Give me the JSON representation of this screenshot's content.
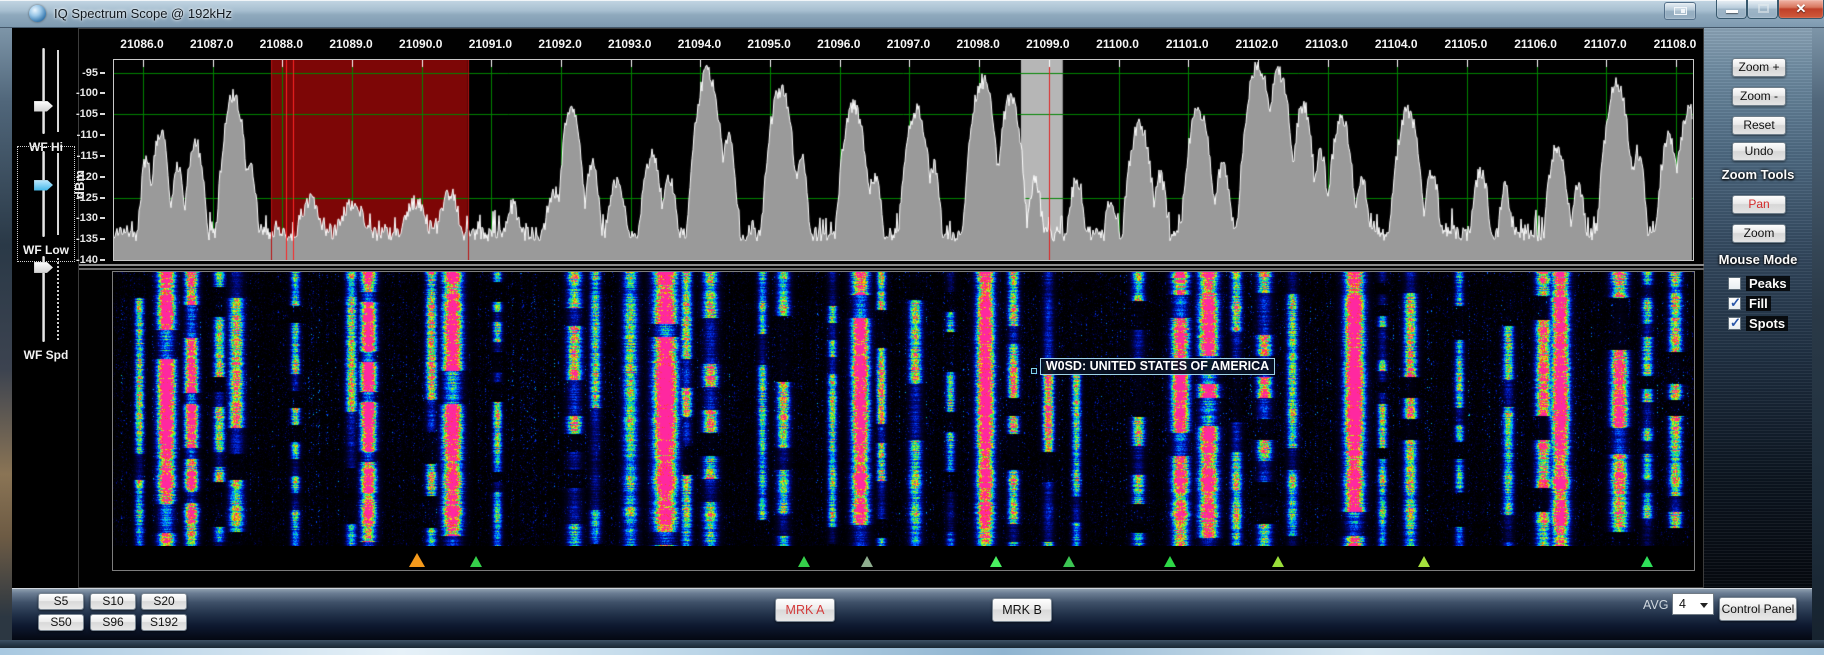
{
  "window": {
    "title": "IQ Spectrum Scope @ 192kHz",
    "close_glyph": "✕"
  },
  "left_rail": {
    "sliders": [
      {
        "label": "WF Hi",
        "value": 0.7,
        "focused": false,
        "ticks": "solid"
      },
      {
        "label": "WF Low",
        "value": 0.38,
        "focused": true,
        "ticks": "solid"
      },
      {
        "label": "WF Spd",
        "value": 0.08,
        "focused": false,
        "ticks": "dotted"
      }
    ]
  },
  "right_rail": {
    "buttons_zoom": [
      {
        "label": "Zoom +"
      },
      {
        "label": "Zoom -"
      },
      {
        "label": "Reset"
      },
      {
        "label": "Undo"
      }
    ],
    "zoom_tools_label": "Zoom Tools",
    "buttons_mouse": [
      {
        "label": "Pan",
        "active": true
      },
      {
        "label": "Zoom",
        "active": false
      }
    ],
    "mouse_mode_label": "Mouse Mode",
    "checkboxes": [
      {
        "label": "Peaks",
        "checked": false
      },
      {
        "label": "Fill",
        "checked": true
      },
      {
        "label": "Spots",
        "checked": true
      }
    ],
    "active_text_color": "#d42a2a"
  },
  "bottom_bar": {
    "span_buttons": [
      "S5",
      "S10",
      "S20",
      "S50",
      "S96",
      "S192"
    ],
    "mrk_a_label": "MRK A",
    "mrk_b_label": "MRK B",
    "avg_label": "AVG",
    "avg_value": "4",
    "control_panel_label": "Control Panel"
  },
  "waterfall_tooltip": {
    "text": "W0SD: UNITED STATES OF AMERICA",
    "anchor_khz": 21099.0
  },
  "chart_data": {
    "type": "spectrum-and-waterfall",
    "x_axis": {
      "unit": "kHz",
      "start": 21086.0,
      "end": 21108.0,
      "step": 1.0,
      "tick_labels": [
        "21086.0",
        "21087.0",
        "21088.0",
        "21089.0",
        "21090.0",
        "21091.0",
        "21092.0",
        "21093.0",
        "21094.0",
        "21095.0",
        "21096.0",
        "21097.0",
        "21098.0",
        "21099.0",
        "21100.0",
        "21101.0",
        "21102.0",
        "21103.0",
        "21104.0",
        "21105.0",
        "21106.0",
        "21107.0",
        "21108.0"
      ],
      "plot_start": 21085.58,
      "plot_end": 21108.26
    },
    "y_axis": {
      "label": "dBm",
      "tick_labels": [
        "-95",
        "-100",
        "-105",
        "-110",
        "-115",
        "-120",
        "-125",
        "-130",
        "-135",
        "-140"
      ],
      "top_dbm": -92,
      "bottom_dbm": -140
    },
    "grid": {
      "color": "#008500",
      "vertical_khz_every": 1.0,
      "horizontal_dbm": [
        -95,
        -105,
        -125
      ]
    },
    "noise_floor_dbm": -134,
    "spectrum_fill_color": "#9a9a9a",
    "spectrum_line_color": "#ffffff",
    "regions": [
      {
        "name": "selection-red",
        "from_khz": 21087.84,
        "to_khz": 21090.66,
        "fill": "#7d0606",
        "edge_line_color": "#b81212",
        "inner_lines_khz": [
          21088.05,
          21088.15
        ],
        "inner_line_color": "#ff2424"
      },
      {
        "name": "marker-band-gray",
        "from_khz": 21098.6,
        "to_khz": 21099.2,
        "fill": "#b6b6b6",
        "center_line_khz": 21099.0,
        "center_line_color": "#e02020"
      }
    ],
    "peaks_format": "[kHz, dBm, width_kHz]",
    "peaks": [
      [
        21086.05,
        -116,
        0.06
      ],
      [
        21086.25,
        -109,
        0.07
      ],
      [
        21086.5,
        -117,
        0.06
      ],
      [
        21086.75,
        -112,
        0.08
      ],
      [
        21087.3,
        -100,
        0.09
      ],
      [
        21087.55,
        -118,
        0.06
      ],
      [
        21088.4,
        -126,
        0.15
      ],
      [
        21089.0,
        -127,
        0.2
      ],
      [
        21089.9,
        -126,
        0.15
      ],
      [
        21090.4,
        -124,
        0.12
      ],
      [
        21091.3,
        -127,
        0.1
      ],
      [
        21091.9,
        -124,
        0.1
      ],
      [
        21092.15,
        -103,
        0.08
      ],
      [
        21092.45,
        -117,
        0.07
      ],
      [
        21092.8,
        -121,
        0.1
      ],
      [
        21093.3,
        -115,
        0.09
      ],
      [
        21093.55,
        -120,
        0.08
      ],
      [
        21094.1,
        -95,
        0.1
      ],
      [
        21094.4,
        -111,
        0.07
      ],
      [
        21095.15,
        -99,
        0.1
      ],
      [
        21095.45,
        -115,
        0.06
      ],
      [
        21096.2,
        -103,
        0.1
      ],
      [
        21096.5,
        -120,
        0.07
      ],
      [
        21097.1,
        -104,
        0.1
      ],
      [
        21097.35,
        -117,
        0.06
      ],
      [
        21098.05,
        -97,
        0.1
      ],
      [
        21098.45,
        -101,
        0.09
      ],
      [
        21098.8,
        -121,
        0.07
      ],
      [
        21099.4,
        -121,
        0.08
      ],
      [
        21099.9,
        -126,
        0.08
      ],
      [
        21100.3,
        -108,
        0.1
      ],
      [
        21100.6,
        -120,
        0.07
      ],
      [
        21101.15,
        -104,
        0.1
      ],
      [
        21101.5,
        -117,
        0.07
      ],
      [
        21102.0,
        -93,
        0.1
      ],
      [
        21102.3,
        -95,
        0.09
      ],
      [
        21102.65,
        -103,
        0.08
      ],
      [
        21102.9,
        -114,
        0.06
      ],
      [
        21103.2,
        -106,
        0.09
      ],
      [
        21103.5,
        -121,
        0.07
      ],
      [
        21104.15,
        -104,
        0.1
      ],
      [
        21104.5,
        -119,
        0.07
      ],
      [
        21105.2,
        -119,
        0.08
      ],
      [
        21105.55,
        -123,
        0.07
      ],
      [
        21106.3,
        -113,
        0.09
      ],
      [
        21106.6,
        -122,
        0.07
      ],
      [
        21107.15,
        -98,
        0.1
      ],
      [
        21107.45,
        -114,
        0.07
      ],
      [
        21107.9,
        -110,
        0.08
      ],
      [
        21108.2,
        -104,
        0.1
      ]
    ],
    "waterfall_signals_format": "[kHz, strength_0_1, width_kHz]",
    "waterfall_signals": [
      [
        21085.95,
        0.5,
        0.05
      ],
      [
        21086.35,
        0.95,
        0.09
      ],
      [
        21086.7,
        0.8,
        0.07
      ],
      [
        21087.1,
        0.55,
        0.06
      ],
      [
        21087.35,
        0.6,
        0.08
      ],
      [
        21088.2,
        0.5,
        0.05
      ],
      [
        21089.0,
        0.55,
        0.06
      ],
      [
        21089.25,
        0.9,
        0.08
      ],
      [
        21090.15,
        0.6,
        0.06
      ],
      [
        21090.45,
        0.95,
        0.1
      ],
      [
        21091.1,
        0.5,
        0.05
      ],
      [
        21092.2,
        0.6,
        0.08
      ],
      [
        21092.5,
        0.5,
        0.06
      ],
      [
        21093.0,
        0.5,
        0.08
      ],
      [
        21093.5,
        0.98,
        0.12
      ],
      [
        21093.8,
        0.6,
        0.06
      ],
      [
        21094.15,
        0.6,
        0.08
      ],
      [
        21094.9,
        0.45,
        0.05
      ],
      [
        21095.2,
        0.55,
        0.07
      ],
      [
        21095.9,
        0.5,
        0.05
      ],
      [
        21096.3,
        0.9,
        0.09
      ],
      [
        21096.6,
        0.6,
        0.05
      ],
      [
        21097.1,
        0.55,
        0.07
      ],
      [
        21097.6,
        0.45,
        0.05
      ],
      [
        21098.1,
        0.92,
        0.09
      ],
      [
        21098.5,
        0.6,
        0.06
      ],
      [
        21099.0,
        0.65,
        0.06
      ],
      [
        21099.4,
        0.5,
        0.05
      ],
      [
        21100.3,
        0.55,
        0.07
      ],
      [
        21100.9,
        0.85,
        0.09
      ],
      [
        21101.3,
        0.9,
        0.1
      ],
      [
        21101.7,
        0.6,
        0.06
      ],
      [
        21102.1,
        0.65,
        0.08
      ],
      [
        21102.5,
        0.5,
        0.06
      ],
      [
        21103.4,
        0.95,
        0.1
      ],
      [
        21103.8,
        0.5,
        0.05
      ],
      [
        21104.2,
        0.6,
        0.07
      ],
      [
        21104.9,
        0.45,
        0.05
      ],
      [
        21105.6,
        0.5,
        0.06
      ],
      [
        21106.1,
        0.7,
        0.08
      ],
      [
        21106.35,
        0.9,
        0.09
      ],
      [
        21107.2,
        0.75,
        0.09
      ],
      [
        21107.6,
        0.5,
        0.06
      ],
      [
        21108.0,
        0.6,
        0.07
      ]
    ],
    "spot_markers": [
      {
        "khz": 21089.95,
        "color": "#f59a1c",
        "size": "large"
      },
      {
        "khz": 21090.8,
        "color": "#35d04a",
        "size": "normal"
      },
      {
        "khz": 21095.5,
        "color": "#35d04a",
        "size": "normal"
      },
      {
        "khz": 21096.4,
        "color": "#8fae8f",
        "size": "normal"
      },
      {
        "khz": 21098.25,
        "color": "#49f060",
        "size": "normal"
      },
      {
        "khz": 21099.3,
        "color": "#3cc553",
        "size": "normal"
      },
      {
        "khz": 21100.75,
        "color": "#2ed847",
        "size": "normal"
      },
      {
        "khz": 21102.3,
        "color": "#9ade3a",
        "size": "normal"
      },
      {
        "khz": 21104.4,
        "color": "#a5e03c",
        "size": "normal"
      },
      {
        "khz": 21107.6,
        "color": "#2fe05a",
        "size": "normal"
      }
    ]
  }
}
